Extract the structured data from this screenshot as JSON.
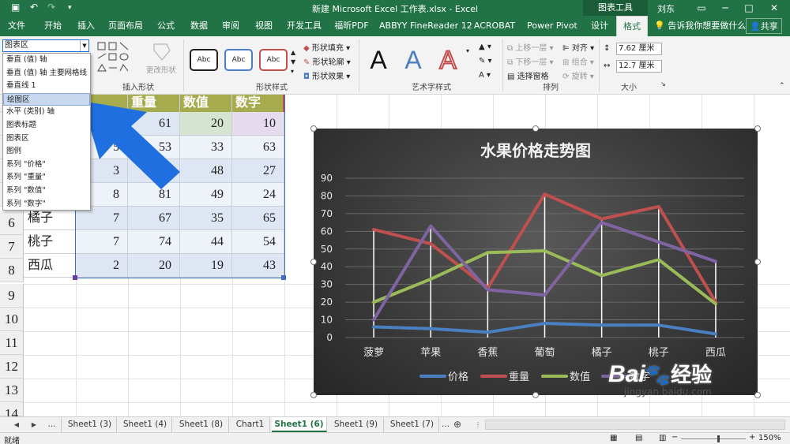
{
  "titlebar": {
    "title": "新建 Microsoft Excel 工作表.xlsx  -  Excel",
    "context_header": "图表工具",
    "user": "刘东",
    "save_icon": "save-icon",
    "undo_icon": "undo-icon",
    "redo_icon": "redo-icon"
  },
  "ribbon_tabs": [
    "文件",
    "开始",
    "插入",
    "页面布局",
    "公式",
    "数据",
    "审阅",
    "视图",
    "开发工具",
    "福昕PDF",
    "ABBYY FineReader 12",
    "ACROBAT",
    "Power Pivot",
    "设计",
    "格式"
  ],
  "active_tab": "格式",
  "tell_me": "告诉我你想要做什么",
  "share": "共享",
  "ribbon": {
    "groups": {
      "insert_shapes": "插入形状",
      "shape_styles": "形状样式",
      "wordart_styles": "艺术字样式",
      "arrange": "排列",
      "size": "大小"
    },
    "change_shape": "更改形状",
    "style_samples": [
      "Abc",
      "Abc",
      "Abc"
    ],
    "shape_fill": "形状填充",
    "shape_outline": "形状轮廓",
    "shape_effects": "形状效果",
    "wordart_letters": [
      "A",
      "A",
      "A"
    ],
    "bring_forward": "上移一层",
    "send_backward": "下移一层",
    "selection_pane": "选择窗格",
    "align": "对齐",
    "group": "组合",
    "rotate": "旋转",
    "height": "7.62 厘米",
    "width": "12.7 厘米"
  },
  "selection_dropdown": {
    "value": "图表区",
    "items": [
      "垂直 (值) 轴",
      "垂直 (值) 轴 主要网格线",
      "垂直线 1",
      "绘图区",
      "水平 (类别) 轴",
      "图表标题",
      "图表区",
      "图例",
      "系列 \"价格\"",
      "系列 \"重量\"",
      "系列 \"数值\"",
      "系列 \"数字\""
    ],
    "highlighted_index": 3
  },
  "sheet": {
    "visible_header_fragment": "格",
    "headers": [
      "重量",
      "数值",
      "数字"
    ],
    "rows": [
      {
        "name": "",
        "b": "6",
        "c": "61",
        "d": "20",
        "e": "10"
      },
      {
        "name": "",
        "b": "5",
        "c": "53",
        "d": "33",
        "e": "63"
      },
      {
        "name": "",
        "b": "3",
        "c": "2",
        "d": "48",
        "e": "27"
      },
      {
        "name": "",
        "b": "8",
        "c": "81",
        "d": "49",
        "e": "24"
      },
      {
        "name": "橘子",
        "b": "7",
        "c": "67",
        "d": "35",
        "e": "65"
      },
      {
        "name": "桃子",
        "b": "7",
        "c": "74",
        "d": "44",
        "e": "54"
      },
      {
        "name": "西瓜",
        "b": "2",
        "c": "20",
        "d": "19",
        "e": "43"
      }
    ],
    "row_numbers": [
      "6",
      "7",
      "8",
      "9",
      "10",
      "11",
      "12",
      "13",
      "14",
      "15"
    ]
  },
  "chart_data": {
    "type": "line",
    "title": "水果价格走势图",
    "categories": [
      "菠萝",
      "苹果",
      "香蕉",
      "葡萄",
      "橘子",
      "桃子",
      "西瓜"
    ],
    "series": [
      {
        "name": "价格",
        "values": [
          6,
          5,
          3,
          8,
          7,
          7,
          2
        ],
        "color": "#4a7fc1"
      },
      {
        "name": "重量",
        "values": [
          61,
          53,
          28,
          81,
          67,
          74,
          20
        ],
        "color": "#c0504d"
      },
      {
        "name": "数值",
        "values": [
          20,
          33,
          48,
          49,
          35,
          44,
          19
        ],
        "color": "#9bbb59"
      },
      {
        "name": "数字",
        "values": [
          10,
          63,
          27,
          24,
          65,
          54,
          43
        ],
        "color": "#8064a2"
      }
    ],
    "ylim": [
      0,
      90
    ],
    "yticks": [
      "0",
      "10",
      "20",
      "30",
      "40",
      "50",
      "60",
      "70",
      "80",
      "90"
    ],
    "drop_lines": true,
    "grid": true,
    "legend": "bottom"
  },
  "sheet_tabs": [
    "...",
    "Sheet1 (3)",
    "Sheet1 (4)",
    "Sheet1 (8)",
    "Chart1",
    "Sheet1 (6)",
    "Sheet1 (9)",
    "Sheet1 (7)",
    "..."
  ],
  "active_sheet": "Sheet1 (6)",
  "status": {
    "ready": "就绪",
    "zoom": "150%"
  },
  "watermark": {
    "brand": "Bai",
    "brand_suffix": "经验",
    "url": "jingyan.baidu.com"
  }
}
